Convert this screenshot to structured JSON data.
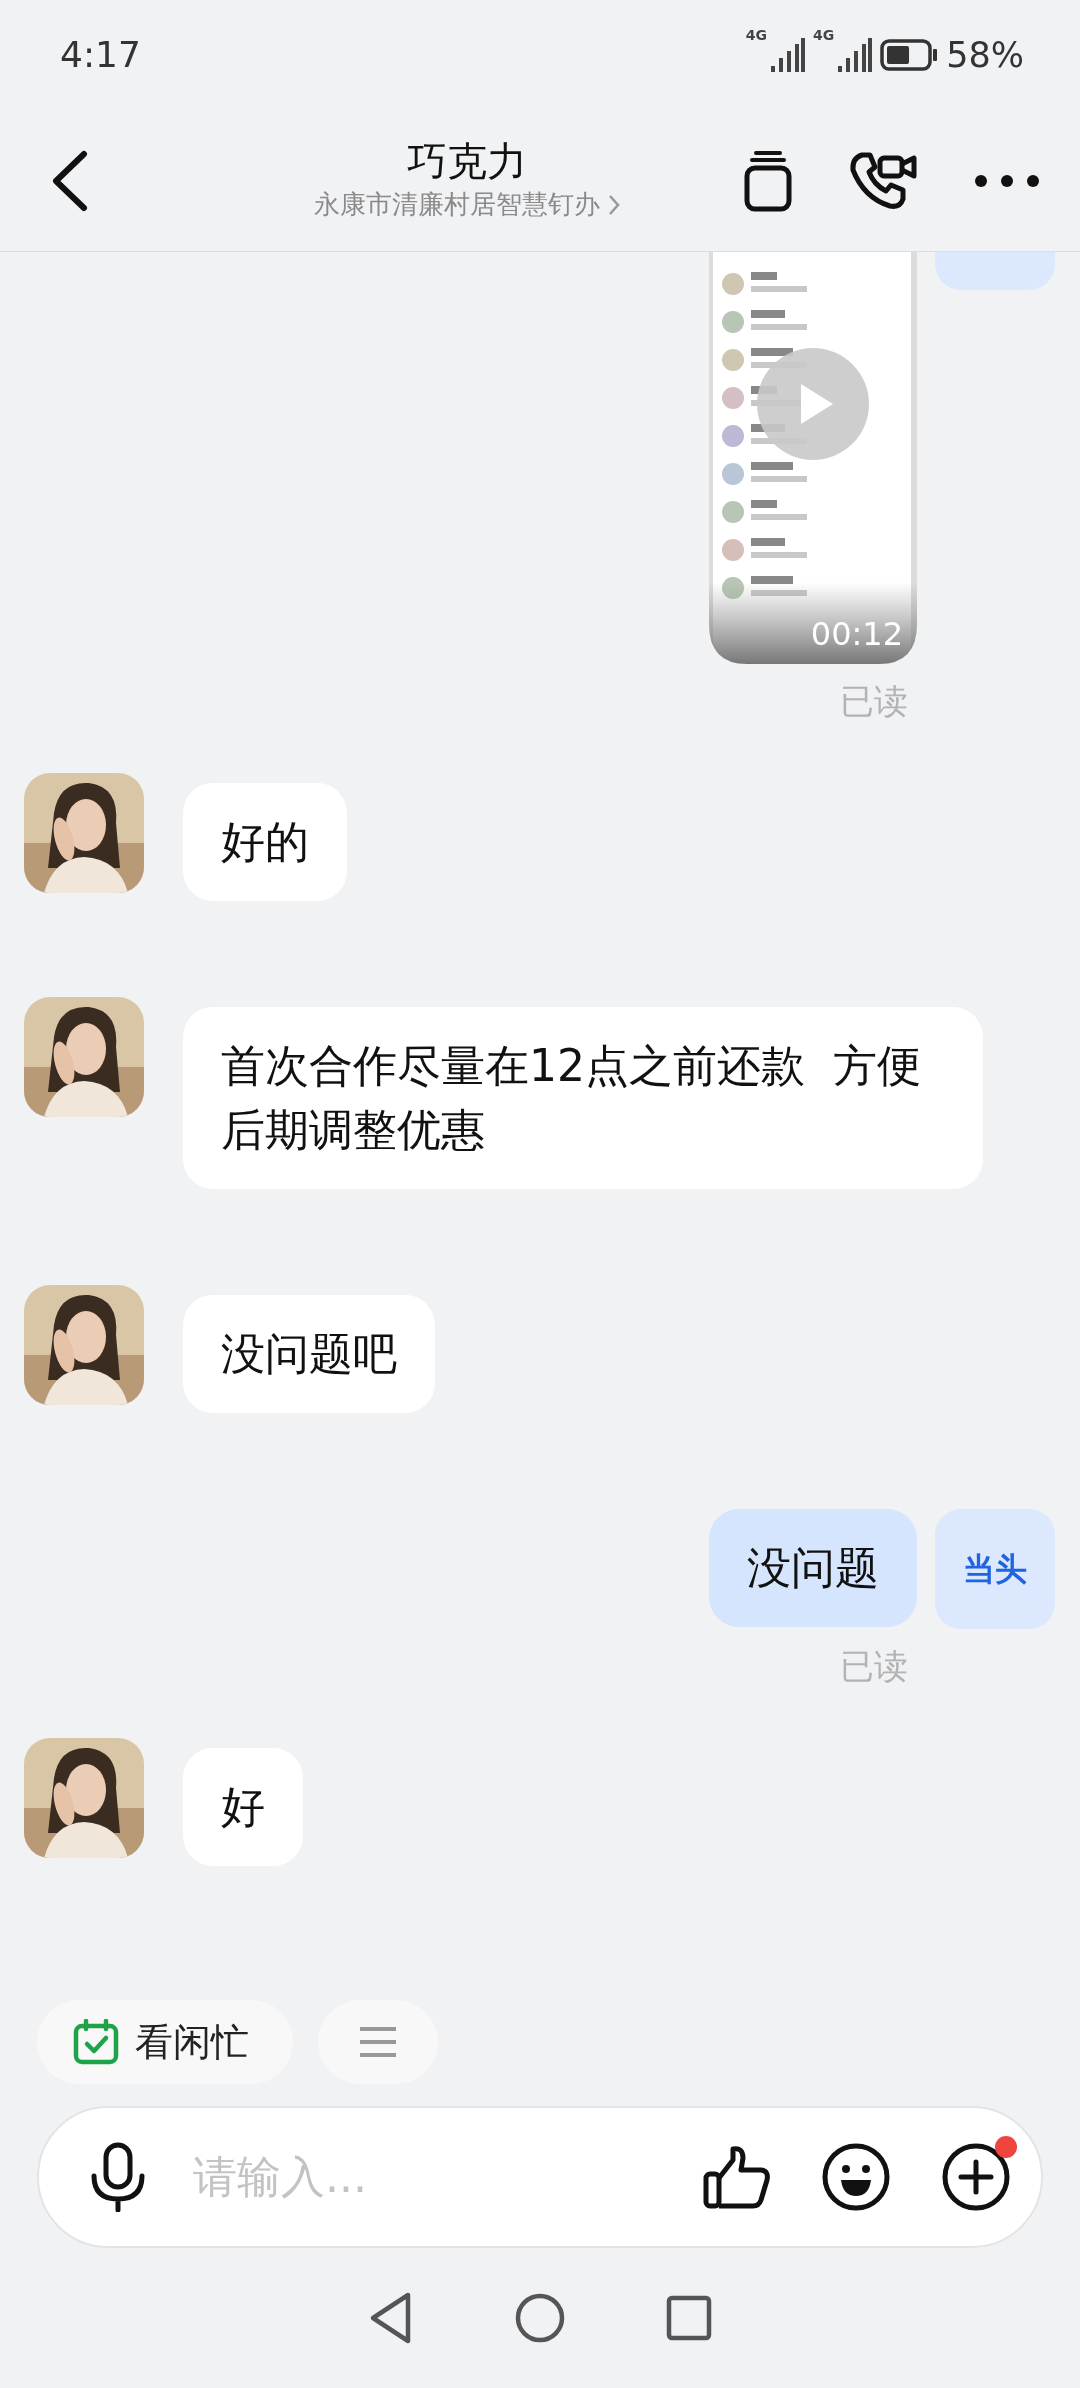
{
  "status_bar": {
    "time": "4:17",
    "network_labels": [
      "4G",
      "4G"
    ],
    "battery": "58%"
  },
  "header": {
    "title": "巧克力",
    "subtitle": "永康市清廉村居智慧钉办"
  },
  "messages": [
    {
      "kind": "outgoing_video",
      "duration": "00:12",
      "receipt": "已读"
    },
    {
      "kind": "incoming_text",
      "text": "好的"
    },
    {
      "kind": "incoming_text",
      "text": "首次合作尽量在12点之前还款  方便后期调整优惠"
    },
    {
      "kind": "incoming_text",
      "text": "没问题吧"
    },
    {
      "kind": "outgoing_text",
      "text": "没问题",
      "avatar": "当头",
      "receipt": "已读"
    },
    {
      "kind": "incoming_text",
      "text": "好"
    }
  ],
  "chips": [
    {
      "label": "看闲忙"
    }
  ],
  "composer": {
    "placeholder": "请输入...",
    "plus_badge": true
  }
}
